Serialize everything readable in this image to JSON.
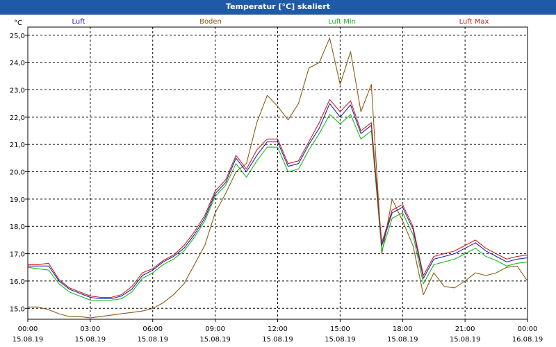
{
  "window": {
    "title": "Temperatur [°C] skaliert"
  },
  "chart_data": {
    "type": "line",
    "title": "Temperatur [°C] skaliert",
    "ylabel": "°C",
    "ylim": [
      14.6,
      25.3
    ],
    "yticks": [
      15.0,
      16.0,
      17.0,
      18.0,
      19.0,
      20.0,
      21.0,
      22.0,
      23.0,
      24.0,
      25.0
    ],
    "ytick_labels": [
      "15,0",
      "16,0",
      "17,0",
      "18,0",
      "19,0",
      "20,0",
      "21,0",
      "22,0",
      "23,0",
      "24,0",
      "25,0"
    ],
    "xlim": [
      0,
      24
    ],
    "xticks": [
      0,
      3,
      6,
      9,
      12,
      15,
      18,
      21,
      24
    ],
    "xtick_time_labels": [
      "00:00",
      "03:00",
      "06:00",
      "09:00",
      "12:00",
      "15:00",
      "18:00",
      "21:00",
      "00:00"
    ],
    "xtick_date_labels": [
      "15.08.19",
      "15.08.19",
      "15.08.19",
      "15.08.19",
      "15.08.19",
      "15.08.19",
      "15.08.19",
      "15.08.19",
      "16.08.19"
    ],
    "grid": true,
    "legend_position": "top",
    "x": [
      0,
      0.5,
      1,
      1.5,
      2,
      2.5,
      3,
      3.5,
      4,
      4.5,
      5,
      5.5,
      6,
      6.5,
      7,
      7.5,
      8,
      8.5,
      9,
      9.5,
      10,
      10.5,
      11,
      11.5,
      12,
      12.5,
      13,
      13.5,
      14,
      14.5,
      15,
      15.5,
      16,
      16.5,
      17,
      17.5,
      18,
      18.5,
      19,
      19.5,
      20,
      20.5,
      21,
      21.5,
      22,
      22.5,
      23,
      23.5,
      24
    ],
    "series": [
      {
        "name": "Luft",
        "color": "#1f1fb4",
        "values": [
          16.55,
          16.55,
          16.55,
          16.0,
          15.7,
          15.55,
          15.4,
          15.35,
          15.35,
          15.45,
          15.7,
          16.2,
          16.4,
          16.7,
          16.9,
          17.2,
          17.7,
          18.3,
          19.2,
          19.6,
          20.5,
          20.0,
          20.6,
          21.1,
          21.1,
          20.2,
          20.3,
          21.0,
          21.6,
          22.5,
          22.0,
          22.45,
          21.4,
          21.7,
          17.3,
          18.5,
          18.7,
          17.9,
          16.1,
          16.8,
          16.9,
          17.0,
          17.2,
          17.4,
          17.1,
          16.9,
          16.7,
          16.8,
          16.85
        ]
      },
      {
        "name": "Boden",
        "color": "#8b5a14",
        "values": [
          15.05,
          15.05,
          14.95,
          14.8,
          14.7,
          14.7,
          14.65,
          14.7,
          14.75,
          14.8,
          14.85,
          14.9,
          15.0,
          15.2,
          15.5,
          15.9,
          16.6,
          17.3,
          18.5,
          19.2,
          20.0,
          20.3,
          21.8,
          22.8,
          22.4,
          21.9,
          22.5,
          23.8,
          24.0,
          24.9,
          23.2,
          24.4,
          22.2,
          23.2,
          17.0,
          19.0,
          18.2,
          17.3,
          15.5,
          16.3,
          15.8,
          15.75,
          16.0,
          16.3,
          16.2,
          16.3,
          16.5,
          16.55,
          16.0
        ]
      },
      {
        "name": "Luft Min",
        "color": "#18b818",
        "values": [
          16.5,
          16.45,
          16.4,
          15.9,
          15.6,
          15.45,
          15.3,
          15.3,
          15.3,
          15.35,
          15.6,
          16.1,
          16.3,
          16.6,
          16.8,
          17.1,
          17.6,
          18.2,
          19.1,
          19.5,
          20.3,
          19.8,
          20.4,
          20.9,
          20.9,
          20.0,
          20.1,
          20.8,
          21.4,
          22.1,
          21.75,
          22.1,
          21.2,
          21.5,
          17.1,
          18.3,
          18.5,
          17.7,
          15.9,
          16.6,
          16.7,
          16.8,
          17.0,
          17.2,
          16.9,
          16.75,
          16.55,
          16.65,
          16.7
        ]
      },
      {
        "name": "Luft Max",
        "color": "#c81e1e",
        "values": [
          16.6,
          16.6,
          16.65,
          16.05,
          15.75,
          15.6,
          15.45,
          15.4,
          15.4,
          15.5,
          15.8,
          16.3,
          16.45,
          16.75,
          16.95,
          17.3,
          17.8,
          18.4,
          19.3,
          19.7,
          20.6,
          20.1,
          20.8,
          21.2,
          21.2,
          20.3,
          20.4,
          21.1,
          21.8,
          22.65,
          22.2,
          22.6,
          21.5,
          21.8,
          17.4,
          18.6,
          18.8,
          18.0,
          16.2,
          16.9,
          17.0,
          17.1,
          17.3,
          17.5,
          17.2,
          17.0,
          16.8,
          16.9,
          16.95
        ]
      }
    ]
  }
}
